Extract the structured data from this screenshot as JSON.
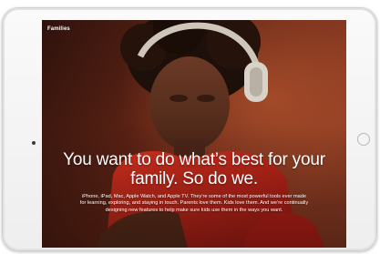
{
  "screen": {
    "section_label": "Families",
    "headline": "You want to do what’s best for your family. So do we.",
    "body": "iPhone, iPad, Mac, Apple Watch, and Apple TV. They’re some of the most powerful tools ever made for learning, exploring, and staying in touch. Parents love them. Kids love them. And we’re continually designing new features to help make sure kids use them in the ways you want."
  },
  "colors": {
    "device_frame": "#f2f2f3",
    "shirt_red": "#c8231c",
    "background_warm": "#7a2a18",
    "headphones": "#d9d2c8"
  },
  "image": {
    "subject": "child wearing headphones looking at a device"
  }
}
